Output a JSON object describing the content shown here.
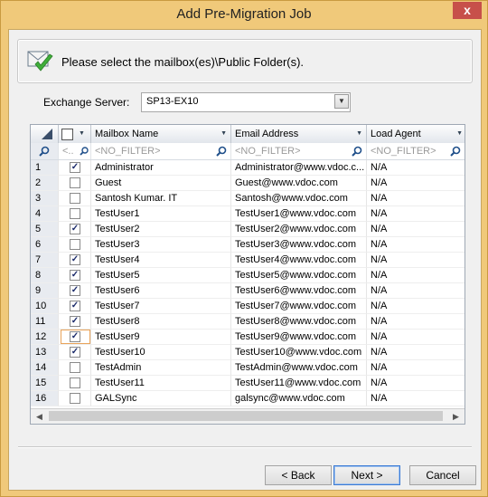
{
  "window": {
    "title": "Add Pre-Migration Job",
    "close_label": "x"
  },
  "header": {
    "message": "Please select the mailbox(es)\\Public Folder(s)."
  },
  "server": {
    "label": "Exchange Server:",
    "value": "SP13-EX10"
  },
  "grid": {
    "columns": [
      "Mailbox Name",
      "Email Address",
      "Load Agent"
    ],
    "filter_placeholder": "<NO_FILTER>",
    "filter_short": "<..",
    "rows": [
      {
        "num": "1",
        "checked": true,
        "name": "Administrator",
        "email": "Administrator@www.vdoc.c...",
        "agent": "N/A"
      },
      {
        "num": "2",
        "checked": false,
        "name": "Guest",
        "email": "Guest@www.vdoc.com",
        "agent": "N/A"
      },
      {
        "num": "3",
        "checked": false,
        "name": "Santosh Kumar. IT",
        "email": "Santosh@www.vdoc.com",
        "agent": "N/A"
      },
      {
        "num": "4",
        "checked": false,
        "name": "TestUser1",
        "email": "TestUser1@www.vdoc.com",
        "agent": "N/A"
      },
      {
        "num": "5",
        "checked": true,
        "name": "TestUser2",
        "email": "TestUser2@www.vdoc.com",
        "agent": "N/A"
      },
      {
        "num": "6",
        "checked": false,
        "name": "TestUser3",
        "email": "TestUser3@www.vdoc.com",
        "agent": "N/A"
      },
      {
        "num": "7",
        "checked": true,
        "name": "TestUser4",
        "email": "TestUser4@www.vdoc.com",
        "agent": "N/A"
      },
      {
        "num": "8",
        "checked": true,
        "name": "TestUser5",
        "email": "TestUser5@www.vdoc.com",
        "agent": "N/A"
      },
      {
        "num": "9",
        "checked": true,
        "name": "TestUser6",
        "email": "TestUser6@www.vdoc.com",
        "agent": "N/A"
      },
      {
        "num": "10",
        "checked": true,
        "name": "TestUser7",
        "email": "TestUser7@www.vdoc.com",
        "agent": "N/A"
      },
      {
        "num": "11",
        "checked": true,
        "name": "TestUser8",
        "email": "TestUser8@www.vdoc.com",
        "agent": "N/A"
      },
      {
        "num": "12",
        "checked": true,
        "name": "TestUser9",
        "email": "TestUser9@www.vdoc.com",
        "agent": "N/A"
      },
      {
        "num": "13",
        "checked": true,
        "name": "TestUser10",
        "email": "TestUser10@www.vdoc.com",
        "agent": "N/A"
      },
      {
        "num": "14",
        "checked": false,
        "name": "TestAdmin",
        "email": "TestAdmin@www.vdoc.com",
        "agent": "N/A"
      },
      {
        "num": "15",
        "checked": false,
        "name": "TestUser11",
        "email": "TestUser11@www.vdoc.com",
        "agent": "N/A"
      },
      {
        "num": "16",
        "checked": false,
        "name": "GALSync",
        "email": "galsync@www.vdoc.com",
        "agent": "N/A"
      }
    ]
  },
  "buttons": {
    "back": "< Back",
    "next": "Next >",
    "cancel": "Cancel"
  },
  "colors": {
    "frame": "#f0c97a",
    "close": "#c7504a"
  }
}
